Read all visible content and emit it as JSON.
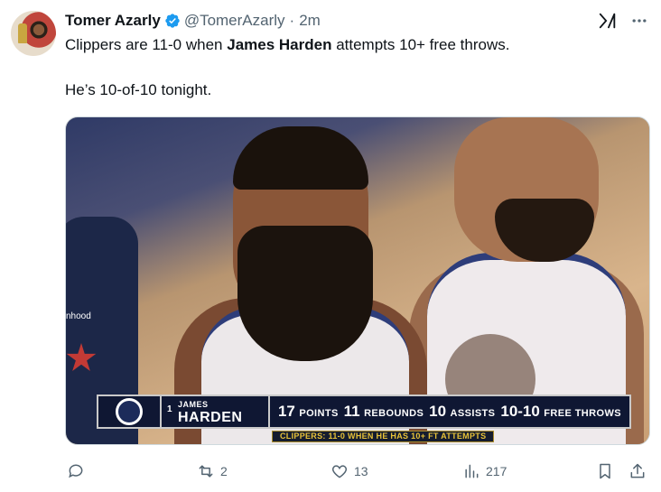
{
  "tweet": {
    "author": {
      "name": "Tomer Azarly",
      "handle": "@TomerAzarly",
      "separator": "·",
      "time": "2m"
    },
    "text": {
      "line1_a": "Clippers are 11-0 when ",
      "line1_bold": "James Harden",
      "line1_b": " attempts 10+ free throws.",
      "line2": "He’s 10-of-10 tonight."
    },
    "media": {
      "scorebug": {
        "jersey_number": "1",
        "first_name": "JAMES",
        "last_name": "HARDEN",
        "stats": [
          {
            "num": "17",
            "label": "POINTS"
          },
          {
            "num": "11",
            "label": "REBOUNDS"
          },
          {
            "num": "10",
            "label": "ASSISTS"
          },
          {
            "num": "10-10",
            "label": "FREE THROWS"
          }
        ],
        "subtitle": "CLIPPERS: 11-0 WHEN HE HAS 10+ FT ATTEMPTS"
      },
      "jersey_text": "nhood"
    },
    "actions": {
      "reply_count": "",
      "retweet_count": "2",
      "like_count": "13",
      "views_count": "217"
    }
  },
  "colors": {
    "verified_blue": "#1d9bf0",
    "muted_text": "#536471",
    "scorebug_navy": "#0f1733",
    "scorebug_gold": "#e8c238"
  },
  "icons": [
    "verified-badge-icon",
    "grok-icon",
    "more-icon",
    "reply-icon",
    "retweet-icon",
    "like-icon",
    "views-icon",
    "bookmark-icon",
    "share-icon"
  ]
}
